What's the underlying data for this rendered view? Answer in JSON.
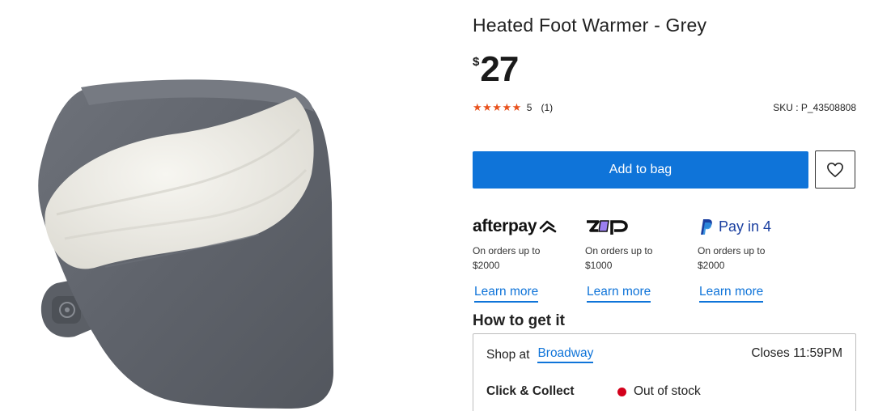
{
  "product": {
    "title": "Heated Foot Warmer - Grey",
    "currency_symbol": "$",
    "price": "27",
    "rating_value": "5",
    "rating_count": "(1)",
    "sku": "SKU : P_43508808",
    "image_icon": "foot-warmer-image"
  },
  "actions": {
    "add_to_bag": "Add to bag",
    "wishlist_icon": "heart-icon"
  },
  "payments": [
    {
      "brand": "afterpay",
      "desc_line1": "On orders up to",
      "desc_line2": "$2000",
      "learn_more": "Learn more"
    },
    {
      "brand": "zip",
      "desc_line1": "On orders up to",
      "desc_line2": "$1000",
      "learn_more": "Learn more"
    },
    {
      "brand": "Pay in 4",
      "desc_line1": "On orders up to",
      "desc_line2": "$2000",
      "learn_more": "Learn more"
    }
  ],
  "fulfilment": {
    "heading": "How to get it",
    "shop_at_label": "Shop at",
    "store_name": "Broadway",
    "closes": "Closes 11:59PM",
    "click_collect_label": "Click & Collect",
    "stock_status": "Out of stock"
  },
  "colors": {
    "accent": "#0f74d9",
    "star": "#e8511c",
    "out_of_stock": "#d3001b"
  }
}
